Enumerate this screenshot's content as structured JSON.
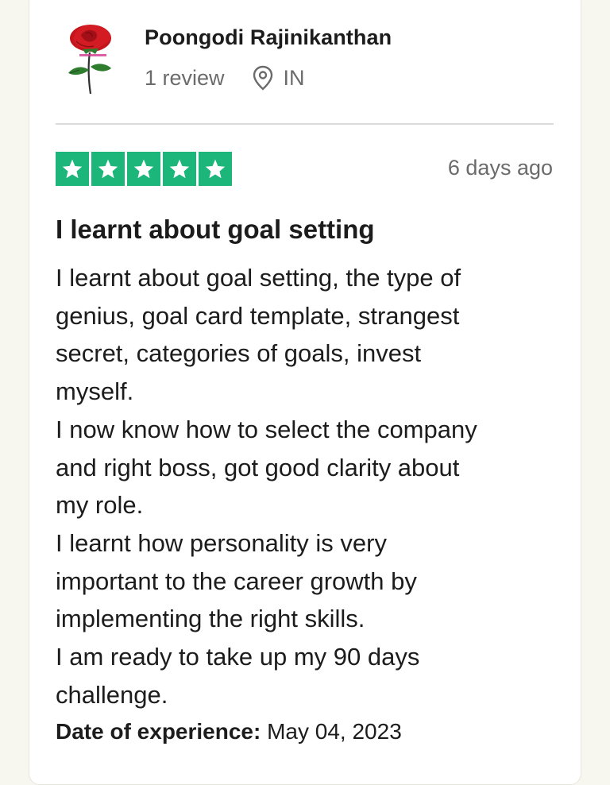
{
  "reviewer": {
    "name": "Poongodi Rajinikanthan",
    "review_count": "1 review",
    "country": "IN",
    "avatar_icon": "rose-logo-icon",
    "location_icon": "location-pin-icon"
  },
  "review": {
    "rating": 5,
    "rating_max": 5,
    "star_color": "#1cb67a",
    "date": "6 days ago",
    "title": "I learnt about goal setting",
    "body_lines": [
      "I learnt about goal setting, the type of",
      "genius, goal card template, strangest",
      "secret, categories of goals, invest",
      "myself.",
      "I now know how to select the company",
      "and right boss, got good clarity about",
      "my role.",
      "I learnt how personality is very",
      "important to the career growth by",
      "implementing the right skills.",
      "I am ready to take up my 90 days",
      "challenge."
    ],
    "experience_label": "Date of experience:",
    "experience_date": "May 04, 2023"
  }
}
